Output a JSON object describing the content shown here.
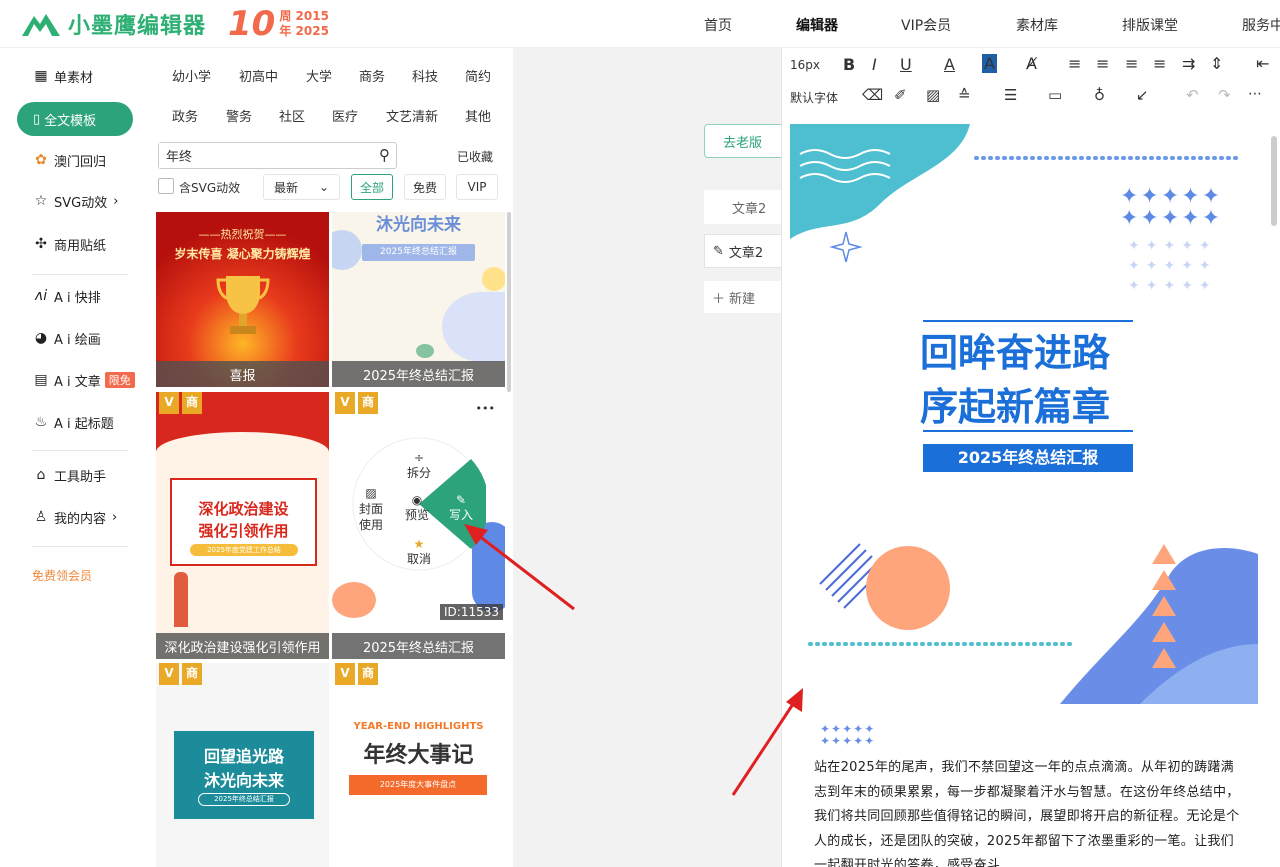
{
  "logo": {
    "brand": "小墨鹰编辑器",
    "anniv": "10",
    "years_top": "周 2015",
    "years_bottom": "年 2025"
  },
  "nav": [
    "首页",
    "编辑器",
    "VIP会员",
    "素材库",
    "排版课堂",
    "服务中"
  ],
  "sidebar": {
    "items": [
      {
        "label": "单素材",
        "icon": "grid-icon"
      },
      {
        "label": "全文模板",
        "icon": "template-icon"
      },
      {
        "label": "澳门回归",
        "icon": "lotus-icon"
      },
      {
        "label": "SVG动效",
        "icon": "star-icon"
      },
      {
        "label": "商用贴纸",
        "icon": "puzzle-icon"
      },
      {
        "label": "A i 快排",
        "icon": "ai-icon"
      },
      {
        "label": "A i 绘画",
        "icon": "palette-icon"
      },
      {
        "label": "A i 文章",
        "icon": "doc-icon",
        "badge": "限免"
      },
      {
        "label": "A i 起标题",
        "icon": "flame-icon"
      },
      {
        "label": "工具助手",
        "icon": "tools-icon"
      },
      {
        "label": "我的内容",
        "icon": "user-icon"
      }
    ],
    "vip_link": "免费领会员"
  },
  "panel": {
    "categories_row1": [
      "幼小学",
      "初高中",
      "大学",
      "商务",
      "科技",
      "简约"
    ],
    "categories_row2": [
      "政务",
      "警务",
      "社区",
      "医疗",
      "文艺清新",
      "其他"
    ],
    "search_value": "年终",
    "collected": "已收藏",
    "svg_check": "含SVG动效",
    "sort": "最新",
    "filters": [
      "全部",
      "免费",
      "VIP"
    ],
    "cards": [
      {
        "caption": "喜报",
        "title1": "——热烈祝贺——",
        "title2": "岁末传喜 凝心聚力铸辉煌"
      },
      {
        "caption": "2025年终总结汇报",
        "title1": "沐光向未来",
        "title2": "2025年终总结汇报"
      },
      {
        "caption": "深化政治建设强化引领作用",
        "title1": "深化政治建设",
        "title2": "强化引领作用",
        "sub": "2025年度党建工作总结"
      },
      {
        "caption": "2025年终总结汇报",
        "id": "ID:11533"
      },
      {
        "title1": "回望追光路",
        "title2": "沐光向未来",
        "sub": "2025年终总结汇报"
      },
      {
        "title1": "YEAR-END HIGHLIGHTS",
        "title2": "年终大事记",
        "sub": "2025年度大事件盘点"
      }
    ],
    "vip_tag": "V",
    "shang_tag": "商",
    "radial": {
      "split": "拆分",
      "cover1": "封面",
      "cover2": "使用",
      "preview": "预览",
      "write": "写入",
      "cancel": "取消"
    },
    "more": "•••"
  },
  "middle": {
    "old_version": "去老版",
    "article_tab": "文章2",
    "article_item": "文章2",
    "new": "新建"
  },
  "toolbar": {
    "font_size": "16px",
    "font_family": "默认字体"
  },
  "doc": {
    "title1": "回眸奋进路",
    "title2": "序起新篇章",
    "banner": "2025年终总结汇报",
    "paragraph": "站在2025年的尾声，我们不禁回望这一年的点点滴滴。从年初的踌躇满志到年末的硕果累累，每一步都凝聚着汗水与智慧。在这份年终总结中，我们将共同回顾那些值得铭记的瞬间，展望即将开启的新征程。无论是个人的成长，还是团队的突破，2025年都留下了浓墨重彩的一笔。让我们一起翻开时光的答卷，感受奋斗"
  },
  "colors": {
    "green": "#2ca37a",
    "blue": "#1a6fd8",
    "teal": "#4ebfd0",
    "orange": "#ffa57c",
    "red_arrow": "#e02020"
  }
}
